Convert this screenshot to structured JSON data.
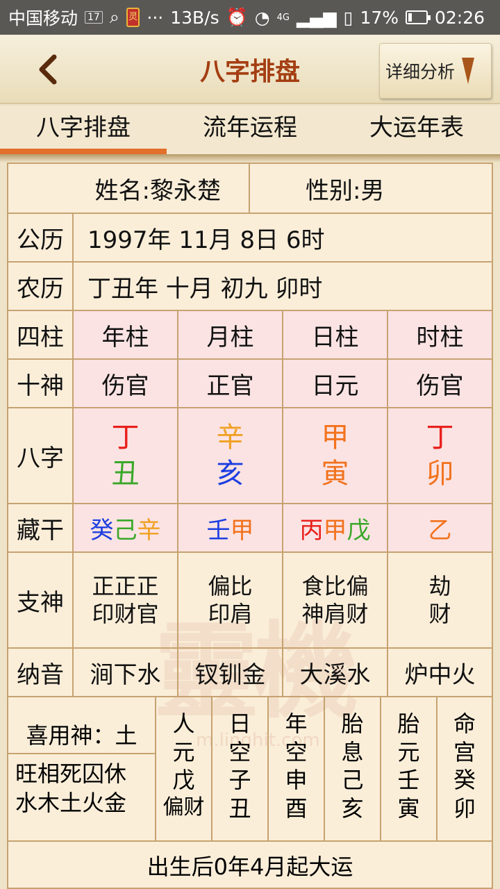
{
  "status_bar": {
    "carrier": "中国移动",
    "sim": "17",
    "speed": "13B/s",
    "network": "4G",
    "battery": "17%",
    "time": "02:26"
  },
  "header": {
    "title": "八字排盘",
    "detail_button": "详细分析"
  },
  "tabs": [
    {
      "label": "八字排盘",
      "active": true
    },
    {
      "label": "流年运程",
      "active": false
    },
    {
      "label": "大运年表",
      "active": false
    }
  ],
  "person": {
    "name": "姓名:黎永楚",
    "gender": "性别:男"
  },
  "solar": {
    "label": "公历",
    "value": "1997年 11月 8日 6时"
  },
  "lunar": {
    "label": "农历",
    "value": "丁丑年 十月 初九 卯时"
  },
  "pillars": {
    "label": "四柱",
    "cols": [
      "年柱",
      "月柱",
      "日柱",
      "时柱"
    ]
  },
  "ten_gods": {
    "label": "十神",
    "cols": [
      "伤官",
      "正官",
      "日元",
      "伤官"
    ]
  },
  "bazi": {
    "label": "八字",
    "stems": [
      {
        "char": "丁",
        "color": "#e8201c"
      },
      {
        "char": "辛",
        "color": "#f0a020"
      },
      {
        "char": "甲",
        "color": "#f2721d"
      },
      {
        "char": "丁",
        "color": "#e8201c"
      }
    ],
    "branches": [
      {
        "char": "丑",
        "color": "#3aa82a"
      },
      {
        "char": "亥",
        "color": "#1c3ee0"
      },
      {
        "char": "寅",
        "color": "#f2721d"
      },
      {
        "char": "卯",
        "color": "#f2721d"
      }
    ]
  },
  "hidden_stems": {
    "label": "藏干",
    "cols": [
      [
        {
          "char": "癸",
          "color": "#1c3ee0"
        },
        {
          "char": "己",
          "color": "#3aa82a"
        },
        {
          "char": "辛",
          "color": "#f0a020"
        }
      ],
      [
        {
          "char": "壬",
          "color": "#1c3ee0"
        },
        {
          "char": "甲",
          "color": "#f2721d"
        }
      ],
      [
        {
          "char": "丙",
          "color": "#e8201c"
        },
        {
          "char": "甲",
          "color": "#f2721d"
        },
        {
          "char": "戊",
          "color": "#3aa82a"
        }
      ],
      [
        {
          "char": "乙",
          "color": "#f2721d"
        }
      ]
    ]
  },
  "branch_gods": {
    "label": "支神",
    "cols": [
      [
        "正正正",
        "印财官"
      ],
      [
        "偏比",
        "印肩"
      ],
      [
        "食比偏",
        "神肩财"
      ],
      [
        "劫",
        "财"
      ]
    ]
  },
  "nayin": {
    "label": "纳音",
    "cols": [
      "涧下水",
      "钗钏金",
      "大溪水",
      "炉中火"
    ]
  },
  "xiyongshen": "喜用神：土",
  "wangxiang": [
    "旺相死囚休",
    "水木土火金"
  ],
  "info_cols": [
    [
      "人",
      "元",
      "戊",
      "偏财"
    ],
    [
      "日",
      "空",
      "子",
      "丑"
    ],
    [
      "年",
      "空",
      "申",
      "酉"
    ],
    [
      "胎",
      "息",
      "己",
      "亥"
    ],
    [
      "胎",
      "元",
      "壬",
      "寅"
    ],
    [
      "命",
      "宫",
      "癸",
      "卯"
    ]
  ],
  "dayun": "出生后0年4月起大运",
  "watermark": "靈機",
  "watermark_url": "m.linghit.com"
}
